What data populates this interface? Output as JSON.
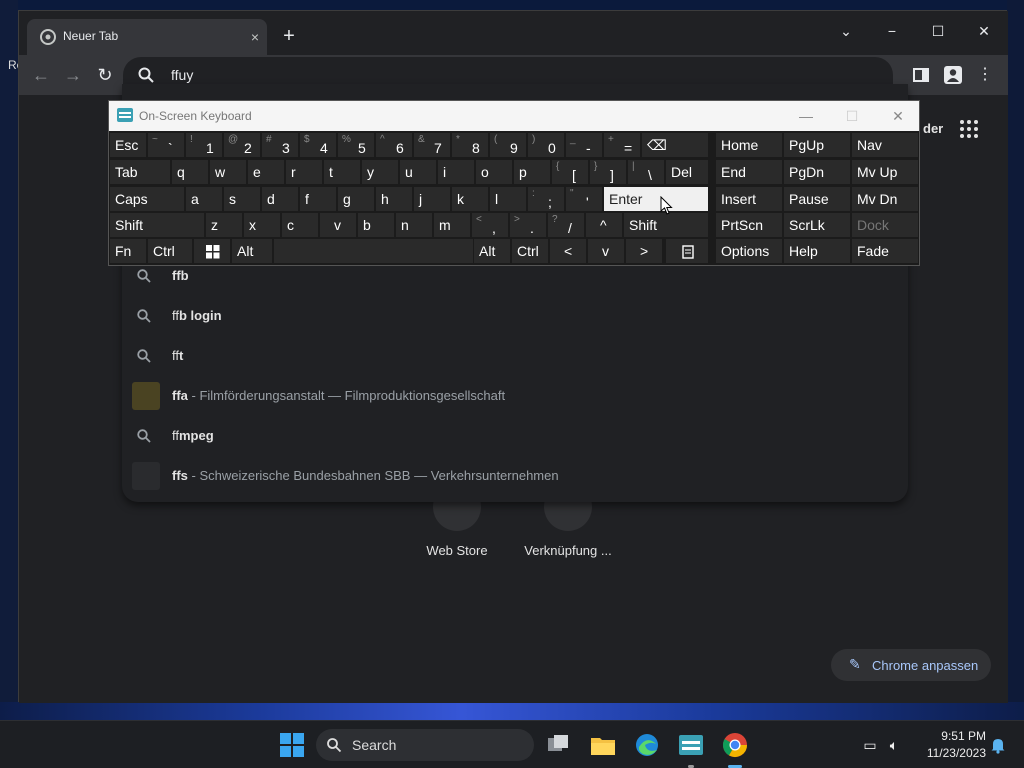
{
  "desktop": {
    "left_label": "Re"
  },
  "browser": {
    "tab_title": "Neuer Tab",
    "tab_close": "×",
    "new_tab": "+",
    "omnibox_text": "ffuy",
    "window_minimize": "−",
    "window_maximize": "☐",
    "window_close": "✕",
    "tabsearch": "⌄"
  },
  "ntp": {
    "label_fragment": "der",
    "shortcuts": [
      "Web Store",
      "Verknüpfung ..."
    ],
    "customize_label": "Chrome anpassen"
  },
  "suggestions": [
    {
      "bold": "ff",
      "rest": "b",
      "sub": "",
      "type": "search"
    },
    {
      "bold": "ff",
      "rest": "b login",
      "sub": "",
      "type": "search"
    },
    {
      "bold": "ff",
      "rest": "t",
      "sub": "",
      "type": "search"
    },
    {
      "bold": "ffa",
      "rest": "",
      "sub": " - Filmförderungsanstalt — Filmproduktionsgesellschaft",
      "type": "entity"
    },
    {
      "bold": "ff",
      "rest": "mpeg",
      "sub": "",
      "type": "search"
    },
    {
      "bold": "ffs",
      "rest": "",
      "sub": " - Schweizerische Bundesbahnen SBB — Verkehrsunternehmen",
      "type": "entity"
    }
  ],
  "osk": {
    "title": "On-Screen Keyboard",
    "row1": [
      {
        "label": "Esc"
      },
      {
        "alt": "~",
        "main": "`"
      },
      {
        "alt": "!",
        "main": "1"
      },
      {
        "alt": "@",
        "main": "2"
      },
      {
        "alt": "#",
        "main": "3"
      },
      {
        "alt": "$",
        "main": "4"
      },
      {
        "alt": "%",
        "main": "5"
      },
      {
        "alt": "^",
        "main": "6"
      },
      {
        "alt": "&",
        "main": "7"
      },
      {
        "alt": "*",
        "main": "8"
      },
      {
        "alt": "(",
        "main": "9"
      },
      {
        "alt": ")",
        "main": "0"
      },
      {
        "alt": "_",
        "main": "-"
      },
      {
        "alt": "+",
        "main": "="
      },
      {
        "label": "⌫"
      },
      {
        "label": "Home"
      },
      {
        "label": "PgUp"
      },
      {
        "label": "Nav"
      }
    ],
    "row2": [
      {
        "label": "Tab"
      },
      {
        "label": "q"
      },
      {
        "label": "w"
      },
      {
        "label": "e"
      },
      {
        "label": "r"
      },
      {
        "label": "t"
      },
      {
        "label": "y"
      },
      {
        "label": "u"
      },
      {
        "label": "i"
      },
      {
        "label": "o"
      },
      {
        "label": "p"
      },
      {
        "alt": "{",
        "main": "["
      },
      {
        "alt": "}",
        "main": "]"
      },
      {
        "alt": "|",
        "main": "\\"
      },
      {
        "label": "Del"
      },
      {
        "label": "End"
      },
      {
        "label": "PgDn"
      },
      {
        "label": "Mv Up"
      }
    ],
    "row3": [
      {
        "label": "Caps"
      },
      {
        "label": "a"
      },
      {
        "label": "s"
      },
      {
        "label": "d"
      },
      {
        "label": "f"
      },
      {
        "label": "g"
      },
      {
        "label": "h"
      },
      {
        "label": "j"
      },
      {
        "label": "k"
      },
      {
        "label": "l"
      },
      {
        "alt": ":",
        "main": ";"
      },
      {
        "alt": "\"",
        "main": "'"
      },
      {
        "label": "Enter"
      },
      {
        "label": "Insert"
      },
      {
        "label": "Pause"
      },
      {
        "label": "Mv Dn"
      }
    ],
    "row4": [
      {
        "label": "Shift"
      },
      {
        "label": "z"
      },
      {
        "label": "x"
      },
      {
        "label": "c"
      },
      {
        "label": "v"
      },
      {
        "label": "b"
      },
      {
        "label": "n"
      },
      {
        "label": "m"
      },
      {
        "alt": "<",
        "main": ","
      },
      {
        "alt": ">",
        "main": "."
      },
      {
        "alt": "?",
        "main": "/"
      },
      {
        "label": "^"
      },
      {
        "label": "Shift"
      },
      {
        "label": "PrtScn"
      },
      {
        "label": "ScrLk"
      },
      {
        "label": "Dock"
      }
    ],
    "row5": [
      {
        "label": "Fn"
      },
      {
        "label": "Ctrl"
      },
      {
        "label": "win"
      },
      {
        "label": "Alt"
      },
      {
        "label": ""
      },
      {
        "label": "Alt"
      },
      {
        "label": "Ctrl"
      },
      {
        "label": "<"
      },
      {
        "label": "v"
      },
      {
        "label": ">"
      },
      {
        "label": "menu"
      },
      {
        "label": "Options"
      },
      {
        "label": "Help"
      },
      {
        "label": "Fade"
      }
    ]
  },
  "taskbar": {
    "search_label": "Search",
    "time": "9:51 PM",
    "date": "11/23/2023"
  }
}
